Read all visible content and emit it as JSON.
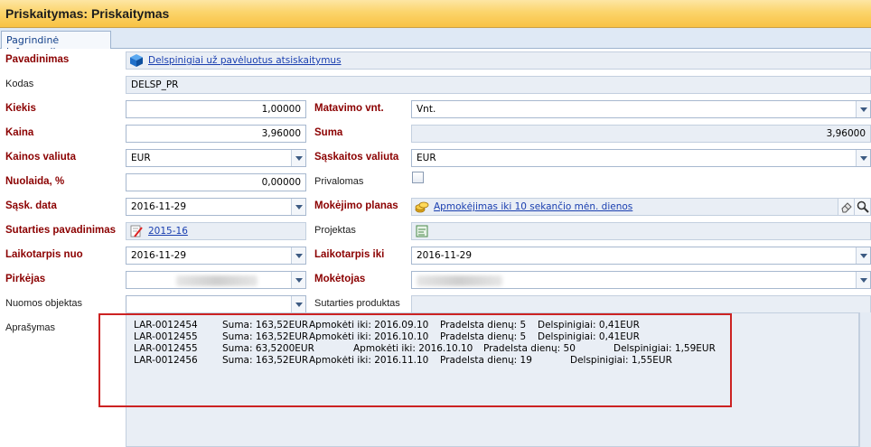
{
  "window": {
    "title": "Priskaitymas: Priskaitymas"
  },
  "tabs": [
    {
      "label": "Pagrindinė informacija"
    }
  ],
  "form": {
    "pavadinimas": {
      "label": "Pavadinimas",
      "value": "Delspinigiai už pavėluotus atsiskaitymus"
    },
    "kodas": {
      "label": "Kodas",
      "value": "DELSP_PR"
    },
    "kiekis": {
      "label": "Kiekis",
      "value": "1,00000"
    },
    "matavimo_vnt": {
      "label": "Matavimo vnt.",
      "value": "Vnt."
    },
    "kaina": {
      "label": "Kaina",
      "value": "3,96000"
    },
    "suma": {
      "label": "Suma",
      "value": "3,96000"
    },
    "kainos_valiuta": {
      "label": "Kainos valiuta",
      "value": "EUR"
    },
    "saskaitos_valiuta": {
      "label": "Sąskaitos valiuta",
      "value": "EUR"
    },
    "nuolaida": {
      "label": "Nuolaida, %",
      "value": "0,00000"
    },
    "privalomas": {
      "label": "Privalomas",
      "checked": false
    },
    "sask_data": {
      "label": "Sąsk. data",
      "value": "2016-11-29"
    },
    "mokejimo_planas": {
      "label": "Mokėjimo planas",
      "value": "Apmokėjimas iki 10 sekančio mėn. dienos"
    },
    "sutarties_pavadinimas": {
      "label": "Sutarties pavadinimas",
      "value": "2015-16"
    },
    "projektas": {
      "label": "Projektas",
      "value": ""
    },
    "laikotarpis_nuo": {
      "label": "Laikotarpis nuo",
      "value": "2016-11-29"
    },
    "laikotarpis_iki": {
      "label": "Laikotarpis iki",
      "value": "2016-11-29"
    },
    "pirkejas": {
      "label": "Pirkėjas",
      "value": ""
    },
    "moketojas": {
      "label": "Mokėtojas",
      "value": ""
    },
    "nuomos_objektas": {
      "label": "Nuomos objektas",
      "value": ""
    },
    "sutarties_produktas": {
      "label": "Sutarties produktas",
      "value": ""
    },
    "aprasymas": {
      "label": "Aprašymas",
      "lines": [
        {
          "code": "LAR-0012454",
          "suma": "Suma: 163,52EUR",
          "apmoketi": "Apmokėti iki: 2016.09.10",
          "pradelsta": "Pradelsta dienų: 5",
          "delspinigiai": "Delspinigiai: 0,41EUR"
        },
        {
          "code": "LAR-0012455",
          "suma": "Suma: 163,52EUR",
          "apmoketi": "Apmokėti iki: 2016.10.10",
          "pradelsta": "Pradelsta dienų: 5",
          "delspinigiai": "Delspinigiai: 0,41EUR"
        },
        {
          "code": "LAR-0012455",
          "suma": "Suma: 63,5200EUR",
          "apmoketi": "Apmokėti iki: 2016.10.10",
          "pradelsta": "Pradelsta dienų: 50",
          "delspinigiai": "Delspinigiai: 1,59EUR"
        },
        {
          "code": "LAR-0012456",
          "suma": "Suma: 163,52EUR",
          "apmoketi": "Apmokėti iki: 2016.11.10",
          "pradelsta": "Pradelsta dienų: 19",
          "delspinigiai": "Delspinigiai: 1,55EUR"
        }
      ]
    }
  },
  "icons": {
    "pavadinimas": "cube-icon",
    "sutartis": "contract-edit-icon",
    "mokejimo_planas": "coins-icon",
    "projektas": "project-icon",
    "clear": "eraser-icon",
    "search": "search-icon"
  }
}
